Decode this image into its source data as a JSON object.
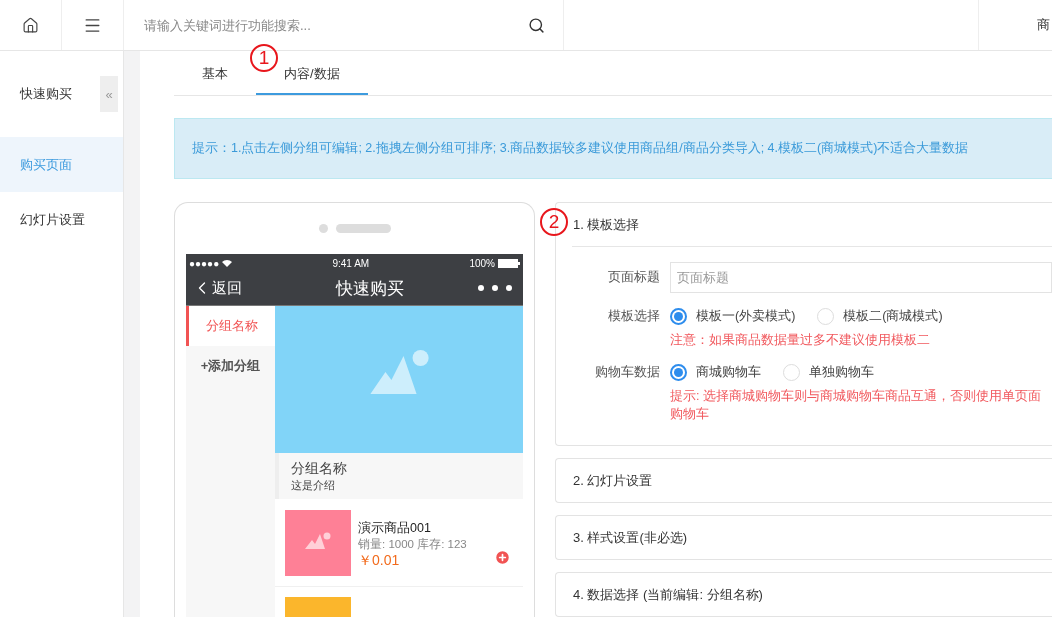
{
  "topbar": {
    "search": {
      "placeholder": "请输入关键词进行功能搜索..."
    },
    "user": "商"
  },
  "sidebar": {
    "title": "快速购买",
    "collapse": "«",
    "items": [
      {
        "label": "购买页面",
        "selected": true
      },
      {
        "label": "幻灯片设置",
        "selected": false
      }
    ]
  },
  "tabs": [
    {
      "label": "基本",
      "selected": false
    },
    {
      "label": "内容/数据",
      "selected": true
    }
  ],
  "notice": "提示：1.点击左侧分组可编辑; 2.拖拽左侧分组可排序; 3.商品数据较多建议使用商品组/商品分类导入; 4.模板二(商城模式)不适合大量数据",
  "annotations": [
    {
      "label": "1"
    },
    {
      "label": "2"
    }
  ],
  "phone": {
    "status": {
      "signal": "●●●●●",
      "time": "9:41 AM",
      "battery": "100%"
    },
    "nav": {
      "back": "返回",
      "title": "快速购买"
    },
    "groups": [
      {
        "label": "分组名称",
        "selected": true
      }
    ],
    "add_group": "+添加分组",
    "group_header": {
      "name": "分组名称",
      "intro": "这是介绍"
    },
    "products": [
      {
        "name": "演示商品001",
        "stats": "销量: 1000 库存: 123",
        "price": "￥0.01",
        "color": "#fe8096"
      },
      {
        "color": "#fbb62c"
      }
    ]
  },
  "sections": [
    {
      "title": "1. 模板选择",
      "fields": [
        {
          "kind": "text",
          "label": "页面标题",
          "placeholder": "页面标题"
        },
        {
          "kind": "radio",
          "label": "模板选择",
          "options": [
            {
              "label": "模板一(外卖模式)",
              "selected": true
            },
            {
              "label": "模板二(商城模式)",
              "selected": false
            }
          ],
          "note": "注意：如果商品数据量过多不建议使用模板二"
        },
        {
          "kind": "radio",
          "label": "购物车数据",
          "options": [
            {
              "label": "商城购物车",
              "selected": true
            },
            {
              "label": "单独购物车",
              "selected": false
            }
          ],
          "note": "提示: 选择商城购物车则与商城购物车商品互通，否则使用单页面购物车"
        }
      ]
    },
    {
      "title": "2. 幻灯片设置"
    },
    {
      "title": "3. 样式设置(非必选)"
    },
    {
      "title": "4. 数据选择 (当前编辑: 分组名称)"
    }
  ]
}
